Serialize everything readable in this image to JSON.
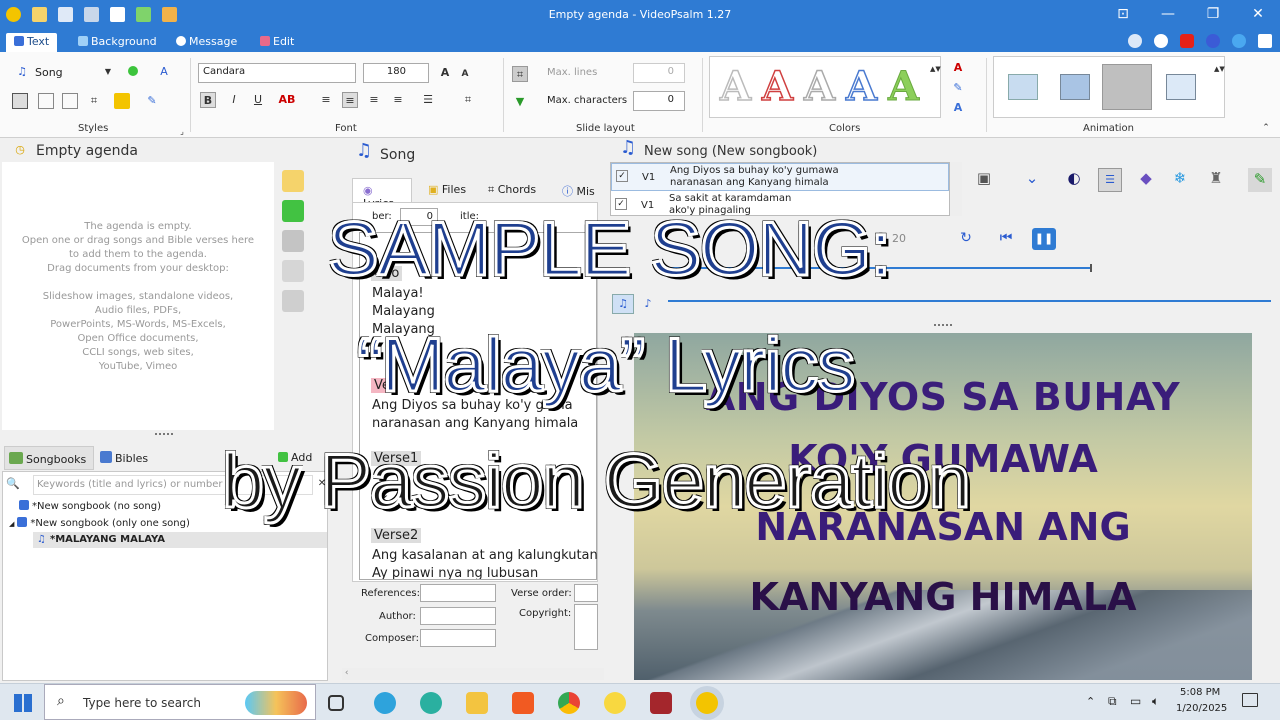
{
  "window": {
    "title": "Empty agenda - VideoPsalm 1.27"
  },
  "ribbon_tabs": [
    {
      "label": "Text"
    },
    {
      "label": "Background"
    },
    {
      "label": "Message"
    },
    {
      "label": "Edit"
    }
  ],
  "ribbon": {
    "styles": {
      "style_value": "Song",
      "group_label": "Styles"
    },
    "font": {
      "family": "Candara",
      "size": "180",
      "group_label": "Font"
    },
    "slide_layout": {
      "max_lines_label": "Max. lines",
      "max_lines_value": "0",
      "max_chars_label": "Max. characters",
      "max_chars_value": "0",
      "group_label": "Slide layout"
    },
    "colors": {
      "group_label": "Colors",
      "letter": "A"
    },
    "animation": {
      "group_label": "Animation"
    }
  },
  "agenda": {
    "title": "Empty agenda",
    "empty_lines": [
      "The agenda is empty.",
      "Open one or drag songs and Bible verses here",
      "to add them to the agenda.",
      "Drag documents from your desktop:",
      "",
      "Slideshow images, standalone videos,",
      "Audio files, PDFs,",
      "PowerPoints, MS-Words, MS-Excels,",
      "Open Office documents,",
      "CCLI songs, web sites,",
      "YouTube, Vimeo"
    ]
  },
  "library": {
    "tabs": [
      {
        "label": "Songbooks"
      },
      {
        "label": "Bibles"
      }
    ],
    "add_label": "Add",
    "search_placeholder": "Keywords (title and lyrics) or number t",
    "tree": [
      {
        "label": "*New songbook (no song)"
      },
      {
        "label": "*New songbook (only one song)"
      },
      {
        "label": "*MALAYANG MALAYA"
      }
    ]
  },
  "song": {
    "title": "Song",
    "tabs": [
      {
        "label": "Lyrics"
      },
      {
        "label": "Files"
      },
      {
        "label": "Chords"
      },
      {
        "label": "Mis"
      }
    ],
    "number_label": "ber:",
    "number_value": "0",
    "title_label": "itle:",
    "chorus_tag": "Cho",
    "lines_chorus": [
      "Malaya!",
      "Malayang",
      "Malayang"
    ],
    "verse1_tag": "Ve",
    "lines_verse1": [
      "Ang Diyos sa buhay ko'y guma",
      "naranasan ang Kanyang himala"
    ],
    "verse1b_tag": "Verse1",
    "line_ak": "ak",
    "verse2_tag": "Verse2",
    "lines_verse2": [
      "Ang kasalanan at ang kalungkutan",
      "Ay pinawi nya ng lubusan"
    ],
    "references_label": "References:",
    "verse_order_label": "Verse order:",
    "author_label": "Author:",
    "copyright_label": "Copyright:",
    "composer_label": "Composer:"
  },
  "newsong": {
    "title": "New song (New songbook)",
    "slides": [
      {
        "tag": "V1",
        "line1": "Ang Diyos sa buhay ko'y gumawa",
        "line2": "naranasan ang Kanyang himala"
      },
      {
        "tag": "V1",
        "line1": "Sa sakit at karamdaman",
        "line2": "ako'y pinagaling"
      }
    ],
    "timer": "20"
  },
  "preview": {
    "lines": [
      "ANG DIYOS SA BUHAY",
      "KO'Y GUMAWA",
      "NARANASAN ANG",
      "KANYANG HIMALA"
    ]
  },
  "overlay": {
    "line1": "SAMPLE SONG:",
    "line2": "“Malaya” Lyrics",
    "line3": "by Passion Generation"
  },
  "taskbar": {
    "search_placeholder": "Type here to search",
    "time": "5:08 PM",
    "date": "1/20/2025"
  },
  "colors": {
    "titlebar": "#2f7bd3",
    "accent": "#1f4e8c",
    "overlay_fill": "#1f3f8f",
    "preview_text": "#3a1d7a"
  }
}
